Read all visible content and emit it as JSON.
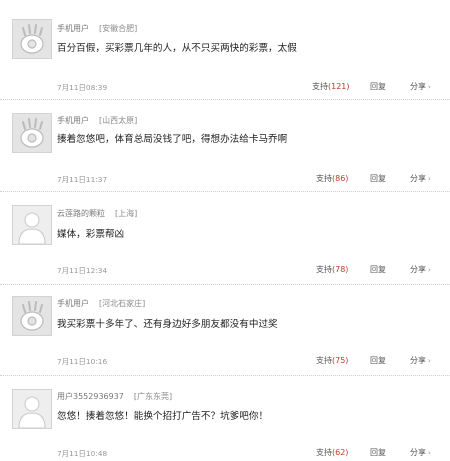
{
  "icons": {
    "avatar_default": "flame-avatar-icon",
    "avatar_blank": "person-silhouette-icon"
  },
  "labels": {
    "support": "支持",
    "reply": "回复",
    "share": "分享",
    "share_arrow": "›"
  },
  "comments": [
    {
      "user": "手机用户",
      "location": "[安徽合肥]",
      "text": "百分百假，买彩票几年的人，从不只买两快的彩票，太假",
      "time": "7月11日08:39",
      "support_count": "(121)",
      "avatar": "flame"
    },
    {
      "user": "手机用户",
      "location": "[山西太原]",
      "text": "揍着忽悠吧，体育总局没钱了吧，得想办法给卡马乔啊",
      "time": "7月11日11:37",
      "support_count": "(86)",
      "avatar": "flame"
    },
    {
      "user": "云莲路的颗粒",
      "location": "[上海]",
      "text": "媒体，彩票帮凶",
      "time": "7月11日12:34",
      "support_count": "(78)",
      "avatar": "person"
    },
    {
      "user": "手机用户",
      "location": "[河北石家庄]",
      "text": "我买彩票十多年了、还有身边好多朋友都没有中过奖",
      "time": "7月11日10:16",
      "support_count": "(75)",
      "avatar": "flame"
    },
    {
      "user": "用户3552936937",
      "location": "[广东东莞]",
      "text": "忽悠！揍着忽悠！能换个招打广告不？坑爹吧你！",
      "time": "7月11日10:48",
      "support_count": "(62)",
      "avatar": "person"
    }
  ]
}
